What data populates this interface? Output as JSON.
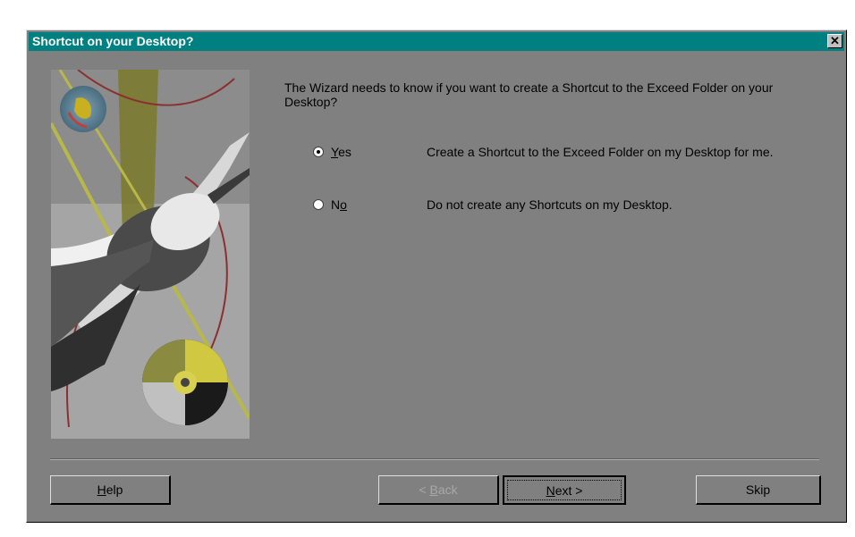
{
  "window": {
    "title": "Shortcut on your Desktop?",
    "close_glyph": "✕"
  },
  "content": {
    "question": "The Wizard needs to know if you want to create a Shortcut to the Exceed Folder on your Desktop?",
    "options": [
      {
        "label": "Yes",
        "mnemonic": "Y",
        "rest": "es",
        "description": "Create a Shortcut to the Exceed Folder on my Desktop for me.",
        "selected": true
      },
      {
        "label": "No",
        "mnemonic": "o",
        "rest": "N",
        "description": "Do not create any Shortcuts on my Desktop.",
        "selected": false
      }
    ]
  },
  "buttons": {
    "help": {
      "label": "Help",
      "mnemonic": "H",
      "rest": "elp"
    },
    "back": {
      "label": "< Back",
      "prefix": "< ",
      "mnemonic": "B",
      "rest": "ack",
      "enabled": false
    },
    "next": {
      "label": "Next >",
      "mnemonic": "N",
      "rest": "ext >"
    },
    "skip": {
      "label": "Skip"
    }
  },
  "colors": {
    "titlebar": "#008080",
    "dialog_bg": "#808080",
    "disabled_text": "#a8a8a8"
  },
  "icons": [
    "close-icon",
    "globe-icon",
    "cd-disc-icon",
    "hummingbird-illustration"
  ]
}
